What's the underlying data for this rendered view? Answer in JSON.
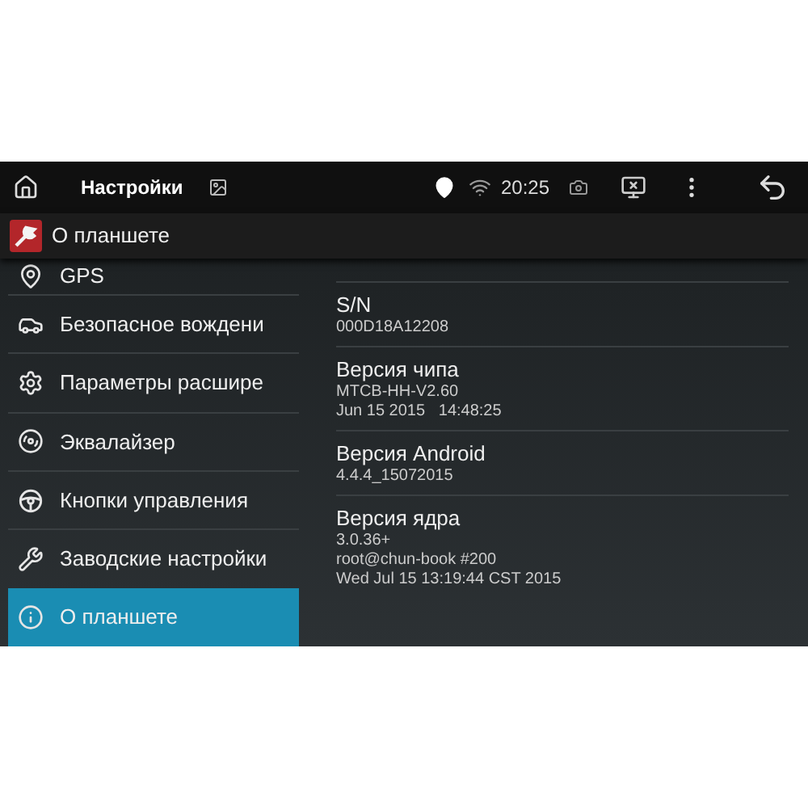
{
  "action_bar": {
    "title": "Настройки",
    "time": "20:25"
  },
  "header": {
    "title": "О планшете"
  },
  "sidebar": {
    "items": [
      {
        "kind": "gps",
        "label": "GPS",
        "selected": false
      },
      {
        "kind": "car",
        "label": "Безопасное вождени",
        "selected": false
      },
      {
        "kind": "gear",
        "label": "Параметры расшире",
        "selected": false
      },
      {
        "kind": "speaker",
        "label": "Эквалайзер",
        "selected": false
      },
      {
        "kind": "wheel",
        "label": "Кнопки управления",
        "selected": false
      },
      {
        "kind": "tools",
        "label": "Заводские настройки",
        "selected": false
      },
      {
        "kind": "info",
        "label": "О планшете",
        "selected": true
      }
    ]
  },
  "details": [
    {
      "title": "S/N",
      "lines": [
        "000D18A12208"
      ]
    },
    {
      "title": "Версия чипа",
      "lines": [
        "MTCB-HH-V2.60",
        "Jun 15 2015   14:48:25"
      ]
    },
    {
      "title": "Версия Android",
      "lines": [
        "4.4.4_15072015"
      ]
    },
    {
      "title": "Версия ядра",
      "lines": [
        "3.0.36+",
        "root@chun-book #200",
        "Wed Jul 15 13:19:44 CST 2015"
      ]
    }
  ]
}
